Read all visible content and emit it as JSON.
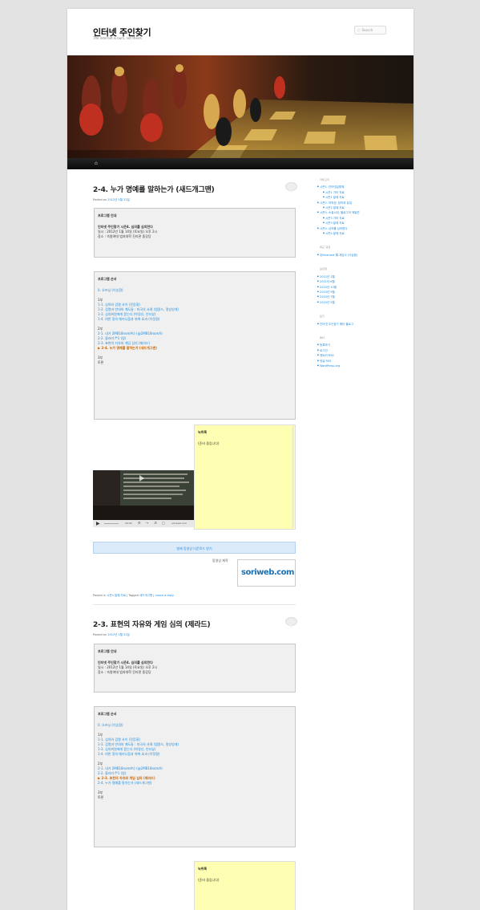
{
  "site": {
    "title": "인터넷 주인찾기",
    "description": "The internet is ours, not theirs.",
    "search_placeholder": "Search",
    "home_icon": "home-icon"
  },
  "posts": [
    {
      "title": "2-4. 누가 명예를 말하는가 (새드개그맨)",
      "posted_prefix": "Posted on",
      "date": "2012년 1월 22일",
      "info": {
        "heading": "프로그램 안내",
        "lines": [
          "인터넷 주인찾기 시즌4. 심의를 심의한다",
          "일시 : 2012년 1월 14일 (토요일) 오후 2시",
          "장소 : 숙명여대 법과대학 진리관 중강당"
        ]
      },
      "order": {
        "heading": "프로그램 순서",
        "intro": "0. 오프닝 (이승환)",
        "part1": "1부",
        "p1": [
          "1-1. 심의와 검열 사이 (전응휘)",
          "1-2. 검열과 반대의 계도들 : 미국의 사례 (엠콩드, 명성빙게)",
          "1-3. 심의위원에게 묻는다 (박경신, 인터뷰)",
          "1-4. 여론 정의 메커니즘과 위축 효과 (이정환)"
        ],
        "part2": "2부",
        "p2": [
          "2-1. 내가 2MB18nomA다 (@2MB18nomA)",
          "2-2. 올라라 f*1 (핑)",
          "2-3. 표현의 자유와 게임 심의 (제라드)",
          "▶ 2-4. 누가 명예를 말하는가 (새드개그맨)"
        ],
        "current": 3,
        "part3": "3부",
        "discussion": "토론"
      },
      "note": {
        "heading": "녹취록",
        "body": "(준비 중입니다)"
      },
      "video": {
        "time": "44:02",
        "brand": "soriweb.com"
      },
      "download": "발제 동영상 다운로드 받기",
      "credit": "동영상 제작",
      "logo": "soriweb.com",
      "footer": {
        "posted_in": "Posted in",
        "cat": "시즌4 발제 자료",
        "tagged": "Tagged",
        "tag": "새드개그맨",
        "reply": "Leave a reply"
      }
    },
    {
      "title": "2-3. 표현의 자유와 게임 심의 (제라드)",
      "posted_prefix": "Posted on",
      "date": "2012년 1월 22일",
      "info": {
        "heading": "프로그램 안내",
        "lines": [
          "인터넷 주인찾기 시즌4. 심의를 심의한다",
          "일시 : 2012년 1월 14일 (토요일) 오후 2시",
          "장소 : 숙명여대 법과대학 진리관 중강당"
        ]
      },
      "order": {
        "heading": "프로그램 순서",
        "intro": "0. 오프닝 (이승환)",
        "part1": "1부",
        "p1": [
          "1-1. 심의와 검열 사이 (전응휘)",
          "1-2. 검열과 반대의 계도들 : 미국의 사례 (엠콩드, 명성빙게)",
          "1-3. 심의위원에게 묻는다 (박경신, 인터뷰)",
          "1-4. 여론 정의 메커니즘과 위축 효과 (이정환)"
        ],
        "part2": "2부",
        "p2": [
          "2-1. 내가 2MB18nomA다 (@2MB18nomA)",
          "2-2. 올라라 f*1 (핑)",
          "▶ 2-3. 표현의 자유와 게임 심의 (제라드)",
          "2-4. 누가 명예를 말하는가 (새드개그맨)"
        ],
        "current": 2,
        "part3": "3부",
        "discussion": "토론"
      },
      "note": {
        "heading": "녹취록",
        "body": "(준비 중입니다)"
      }
    }
  ],
  "sidebar": {
    "categories_title": "카테고리",
    "categories": [
      {
        "t": "시즌1. 인터넷실명제",
        "sub": false
      },
      {
        "t": "시즌1 기타 자료",
        "sub": true
      },
      {
        "t": "시즌1 발제 자료",
        "sub": true
      },
      {
        "t": "시즌2. 저작권, 창작과 유업",
        "sub": false
      },
      {
        "t": "시즌2 발제 자료",
        "sub": true
      },
      {
        "t": "시즌3. 소셜시대, 블로그의 재발견",
        "sub": false
      },
      {
        "t": "시즌3 기타 자료",
        "sub": true
      },
      {
        "t": "시즌3 발제 자료",
        "sub": true
      },
      {
        "t": "시즌4. 심의를 심의한다",
        "sub": false
      },
      {
        "t": "시즌4 발제 자료",
        "sub": true
      }
    ],
    "comments_title": "최근 댓글",
    "comments": [
      "@itrianara 㑳 게임사 (이승환)"
    ],
    "archives_title": "보관함",
    "archives": [
      "2012년 1월",
      "2011년 6월",
      "2010년 10월",
      "2010년 9월",
      "2010년 7월",
      "2010년 5월"
    ],
    "links_title": "링크",
    "links": [
      "인터넷 주인찾기 메타 블로그"
    ],
    "meta_title": "메타",
    "meta": [
      "등록하기",
      "로그인",
      "엔트리 RSS",
      "댓글 RSS",
      "WordPress.org"
    ]
  }
}
